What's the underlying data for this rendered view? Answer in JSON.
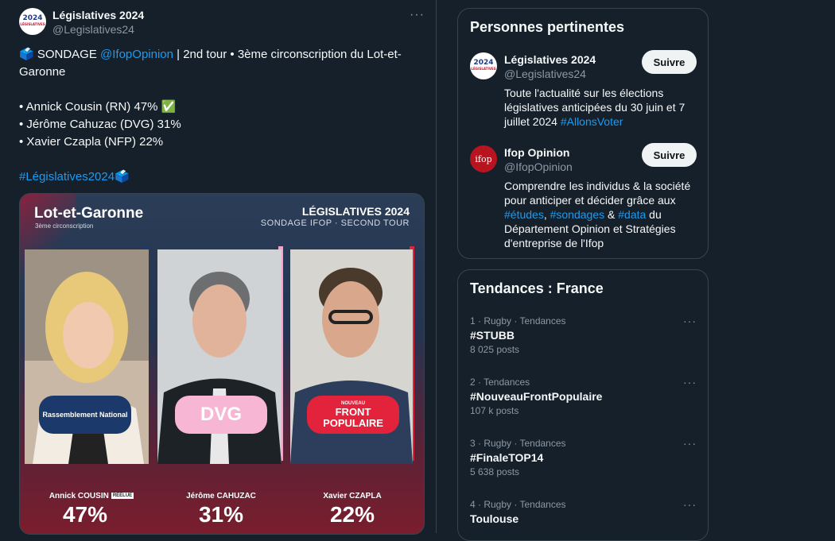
{
  "tweet": {
    "display_name": "Législatives 2024",
    "handle": "@Legislatives24",
    "avatar_text": "2024",
    "avatar_sub": "LÉGISLATIVES",
    "more": "···",
    "line1_prefix": "🗳️ SONDAGE ",
    "line1_mention": "@IfopOpinion",
    "line1_rest": " | 2nd tour • 3ème circonscription du Lot-et-",
    "line2": "Garonne",
    "bullet1": "• Annick Cousin (RN) 47% ✅",
    "bullet2": "• Jérôme Cahuzac (DVG) 31%",
    "bullet3": "• Xavier Czapla (NFP) 22%",
    "hashtag": "#Législatives2024",
    "hashtag_emoji": "🗳️"
  },
  "media": {
    "department": "Lot-et-Garonne",
    "circonscription": "3ème circonscription",
    "title": "LÉGISLATIVES 2024",
    "subtitle": "SONDAGE IFOP · SECOND TOUR",
    "candidates": [
      {
        "name": "Annick COUSIN",
        "badge": "RÉÉLUE",
        "party": "Rassemblement National",
        "percent": "47%",
        "bar_color": "#1b3a6b",
        "party_bg": "#1b3a6b",
        "party_color": "#ffffff"
      },
      {
        "name": "Jérôme CAHUZAC",
        "badge": "",
        "party": "DVG",
        "percent": "31%",
        "bar_color": "#f5a3c7",
        "party_bg": "#f7b6d3",
        "party_color": "#ffffff"
      },
      {
        "name": "Xavier CZAPLA",
        "badge": "",
        "party": "FRONT POPULAIRE",
        "party_small": "NOUVEAU",
        "percent": "22%",
        "bar_color": "#e2233b",
        "party_bg": "#e2233b",
        "party_color": "#ffffff"
      }
    ]
  },
  "relevant": {
    "title": "Personnes pertinentes",
    "people": [
      {
        "name": "Législatives 2024",
        "handle": "@Legislatives24",
        "follow": "Suivre",
        "bio_parts": [
          "Toute l'actualité sur les élections législatives anticipées du 30 juin et 7 juillet 2024 ",
          "#AllonsVoter"
        ]
      },
      {
        "name": "Ifop Opinion",
        "handle": "@IfopOpinion",
        "follow": "Suivre",
        "avatar_text": "ifop",
        "bio_a": "Comprendre les individus & la société pour anticiper et décider grâce aux ",
        "tag1": "#études",
        "sep1": ", ",
        "tag2": "#sondages",
        "sep2": " & ",
        "tag3": "#data",
        "bio_b": " du Département Opinion et Stratégies d'entreprise de l'Ifop"
      }
    ]
  },
  "trends": {
    "title": "Tendances : France",
    "more": "···",
    "items": [
      {
        "meta": "1 · Rugby · Tendances",
        "name": "#STUBB",
        "posts": "8 025 posts"
      },
      {
        "meta": "2 · Tendances",
        "name": "#NouveauFrontPopulaire",
        "posts": "107 k posts"
      },
      {
        "meta": "3 · Rugby · Tendances",
        "name": "#FinaleTOP14",
        "posts": "5 638 posts"
      },
      {
        "meta": "4 · Rugby · Tendances",
        "name": "Toulouse",
        "posts": ""
      }
    ]
  },
  "colors": {
    "background": "#15202b",
    "link": "#1d9bf0",
    "border": "#38444d"
  }
}
